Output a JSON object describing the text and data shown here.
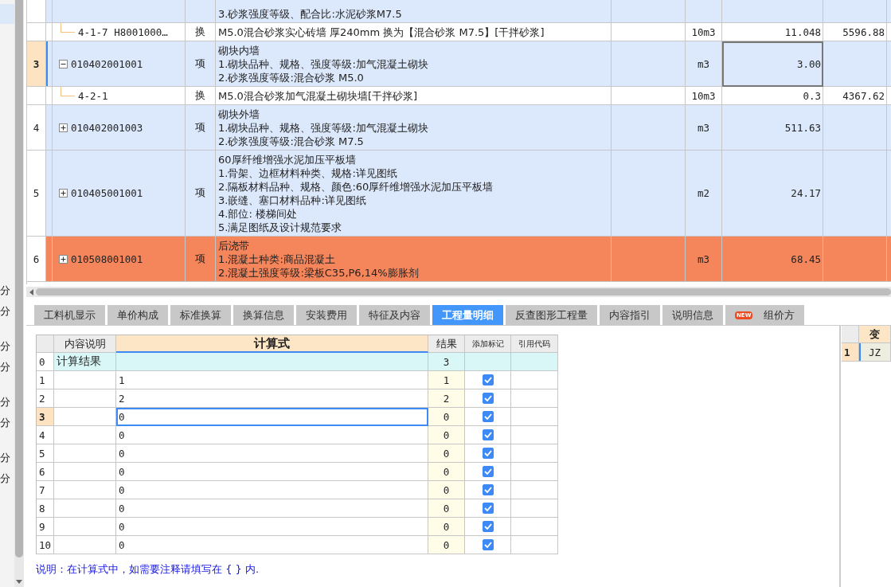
{
  "left_panel": {
    "items": [
      {
        "selected": true
      }
    ],
    "groups": [
      [
        "分",
        "分"
      ],
      [
        "分",
        "分"
      ],
      [
        "分",
        "分"
      ],
      [
        "分",
        "分"
      ]
    ]
  },
  "bill_table": {
    "rows": [
      {
        "kind": "item",
        "cut_off": true,
        "index": "",
        "code": "",
        "type": "",
        "description": [
          "3.砂浆强度等级、配合比:水泥砂浆M7.5"
        ],
        "unit": "",
        "quantity": "",
        "price": ""
      },
      {
        "kind": "sub",
        "index": "",
        "code": "4-1-7 H8001000…",
        "type": "换",
        "description": [
          "M5.0混合砂浆实心砖墙 厚240mm  换为【混合砂浆 M7.5】[干拌砂浆]"
        ],
        "unit": "10m3",
        "quantity": "11.048",
        "price": "5596.88"
      },
      {
        "kind": "item",
        "index": "3",
        "selected": true,
        "expanded": true,
        "code": "010402001001",
        "type": "项",
        "description": [
          "砌块内墙",
          "1.砌块品种、规格、强度等级:加气混凝土砌块",
          "2.砂浆强度等级:混合砂浆 M5.0"
        ],
        "unit": "m3",
        "quantity": "3.00",
        "price": ""
      },
      {
        "kind": "sub",
        "index": "",
        "code": "4-2-1",
        "type": "换",
        "description": [
          "M5.0混合砂浆加气混凝土砌块墙[干拌砂浆]"
        ],
        "unit": "10m3",
        "quantity": "0.3",
        "price": "4367.62"
      },
      {
        "kind": "item",
        "index": "4",
        "selected": false,
        "expanded": false,
        "code": "010402001003",
        "type": "项",
        "description": [
          "砌块外墙",
          "1.砌块品种、规格、强度等级:加气混凝土砌块",
          "2.砂浆强度等级:混合砂浆 M7.5"
        ],
        "unit": "m3",
        "quantity": "511.63",
        "price": ""
      },
      {
        "kind": "item",
        "index": "5",
        "selected": false,
        "expanded": false,
        "code": "010405001001",
        "type": "项",
        "description": [
          "60厚纤维增强水泥加压平板墙",
          "1.骨架、边框材料种类、规格:详见图纸",
          "2.隔板材料品种、规格、颜色:60厚纤维增强水泥加压平板墙",
          "3.嵌缝、塞口材料品种:详见图纸",
          "4.部位: 楼梯间处",
          "5.满足图纸及设计规范要求"
        ],
        "unit": "m2",
        "quantity": "24.17",
        "price": ""
      },
      {
        "kind": "item",
        "index": "6",
        "selected": false,
        "expanded": false,
        "highlighted": true,
        "code": "010508001001",
        "type": "项",
        "description": [
          "后浇带",
          "1.混凝土种类:商品混凝土",
          "2.混凝土强度等级:梁板C35,P6,14%膨胀剂"
        ],
        "unit": "m3",
        "quantity": "68.45",
        "price": ""
      }
    ]
  },
  "tabs": [
    {
      "label": "工料机显示",
      "selected": false
    },
    {
      "label": "单价构成",
      "selected": false
    },
    {
      "label": "标准换算",
      "selected": false
    },
    {
      "label": "换算信息",
      "selected": false
    },
    {
      "label": "安装费用",
      "selected": false
    },
    {
      "label": "特征及内容",
      "selected": false
    },
    {
      "label": "工程量明细",
      "selected": true
    },
    {
      "label": "反查图形工程量",
      "selected": false
    },
    {
      "label": "内容指引",
      "selected": false
    },
    {
      "label": "说明信息",
      "selected": false
    },
    {
      "label": "组价方",
      "selected": false,
      "badge": "NEW"
    }
  ],
  "quantity_table": {
    "columns": [
      "内容说明",
      "计算式",
      "结果",
      "添加标记",
      "引用代码"
    ],
    "rows": [
      {
        "kind": "total",
        "index": "0",
        "note": "计算结果",
        "formula": "",
        "result": "3",
        "selected": false
      },
      {
        "kind": "line",
        "index": "1",
        "formula": "1",
        "result": "1",
        "checked": true,
        "selected": false
      },
      {
        "kind": "line",
        "index": "2",
        "formula": "2",
        "result": "2",
        "checked": true,
        "selected": false
      },
      {
        "kind": "line",
        "index": "3",
        "formula": "0",
        "result": "0",
        "checked": true,
        "selected": true
      },
      {
        "kind": "line",
        "index": "4",
        "formula": "0",
        "result": "0",
        "checked": true,
        "selected": false
      },
      {
        "kind": "line",
        "index": "5",
        "formula": "0",
        "result": "0",
        "checked": true,
        "selected": false
      },
      {
        "kind": "line",
        "index": "6",
        "formula": "0",
        "result": "0",
        "checked": true,
        "selected": false
      },
      {
        "kind": "line",
        "index": "7",
        "formula": "0",
        "result": "0",
        "checked": true,
        "selected": false
      },
      {
        "kind": "line",
        "index": "8",
        "formula": "0",
        "result": "0",
        "checked": true,
        "selected": false
      },
      {
        "kind": "line",
        "index": "9",
        "formula": "0",
        "result": "0",
        "checked": true,
        "selected": false
      },
      {
        "kind": "line",
        "index": "10",
        "formula": "0",
        "result": "0",
        "checked": true,
        "selected": false
      }
    ],
    "note": "说明：在计算式中，如需要注释请填写在 { } 内."
  },
  "variable_table": {
    "columns": [
      "变"
    ],
    "rows": [
      {
        "index": "1",
        "value": "JZ"
      }
    ]
  }
}
